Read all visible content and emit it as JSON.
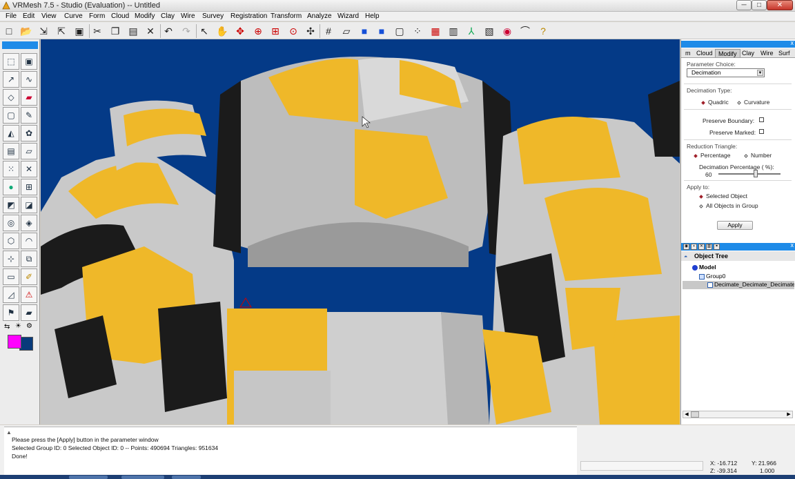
{
  "window": {
    "title": "VRMesh 7.5 - Studio (Evaluation) -- Untitled",
    "buttons": {
      "minimize": "─",
      "maximize": "□",
      "close": "✕"
    }
  },
  "menu": [
    "File",
    "Edit",
    "View",
    "Curve",
    "Form",
    "Cloud",
    "Modify",
    "Clay",
    "Wire",
    "Survey",
    "Registration",
    "Transform",
    "Analyze",
    "Wizard",
    "Help"
  ],
  "toolbar_icons": [
    "new-icon",
    "open-icon",
    "import-icon",
    "export-icon",
    "save-icon",
    "cut-icon",
    "copy-icon",
    "paste-icon",
    "delete-icon",
    "undo-icon",
    "redo-icon",
    "select-icon",
    "pan-icon",
    "rotate-icon",
    "zoom-icon",
    "zoom-window-icon",
    "zoom-fit-icon",
    "zoom-all-icon",
    "grid-icon",
    "grid-skew-icon",
    "shaded-icon",
    "shaded-solid-icon",
    "wireframe-icon",
    "point-display-icon",
    "view-top-icon",
    "view-front-icon",
    "axis-icon",
    "properties-icon",
    "color-map-icon",
    "curvature-icon",
    "help-icon"
  ],
  "palette": {
    "icons": [
      "point-edit-icon",
      "box-select-icon",
      "curve-icon",
      "spline-icon",
      "plane-icon",
      "cut-plane-icon",
      "cube-icon",
      "brush-icon",
      "surface-icon",
      "texture-icon",
      "mesh-icon",
      "parallelogram-icon",
      "scatter-icon",
      "cross-icon",
      "globe-icon",
      "grid-points-icon",
      "fold-icon",
      "sweep-icon",
      "sphere-icon",
      "patch-icon",
      "box-mesh-icon",
      "arc-icon",
      "nodes-icon",
      "connect-icon",
      "patch-flat-icon",
      "pen-icon",
      "triangle-icon",
      "warning-icon",
      "flag-icon",
      "layer-icon"
    ],
    "small_icons": [
      "link-icon",
      "light-icon",
      "gear-icon"
    ],
    "colors": {
      "foreground": "#ff00ff",
      "background": "#083a7a"
    }
  },
  "viewport": {
    "background": "#043a87",
    "scan_colors": {
      "gray": "#c9c9c9",
      "dark": "#1b1b1b",
      "yellow": "#efb829"
    }
  },
  "right_panel": {
    "tabs": [
      "m",
      "Cloud",
      "Modify",
      "Clay",
      "Wire",
      "Surf"
    ],
    "active_tab": "Modify",
    "close": "x",
    "parameter_choice_label": "Parameter Choice:",
    "parameter_choice_value": "Decimation",
    "decimation_type_label": "Decimation Type:",
    "decimation_type_options": [
      "Quadric",
      "Curvature"
    ],
    "decimation_type_selected": "Quadric",
    "preserve_boundary_label": "Preserve Boundary:",
    "preserve_marked_label": "Preserve Marked:",
    "reduction_triangle_label": "Reduction Triangle:",
    "reduction_options": [
      "Percentage",
      "Number"
    ],
    "reduction_selected": "Percentage",
    "decimation_percentage_label": "Decimation Percentage ( %):",
    "decimation_percentage_value": "60",
    "decimation_percentage_fraction": 0.6,
    "apply_to_label": "Apply to:",
    "apply_to_options": [
      "Selected Object",
      "All Objects in Group"
    ],
    "apply_to_selected": "Selected Object",
    "apply_button": "Apply"
  },
  "object_tree": {
    "title": "Object Tree",
    "close": "x",
    "nodes": [
      "Model",
      "Group0",
      "Decimate_Decimate_Decimate"
    ],
    "selected": "Decimate_Decimate_Decimate",
    "scroll_left": "◀",
    "scroll_right": "▶"
  },
  "status": {
    "lines": [
      "Please press the [Apply] button in the parameter window",
      "Selected Group ID: 0  Selected Object ID: 0  -- Points: 490694  Triangles: 951634",
      "Done!"
    ],
    "scroll_indicator": "▲",
    "coords": {
      "x_label": "X: -16.712",
      "y_label": "Y: 21.966",
      "z_label": "Z: -39.314",
      "unit": "1.000"
    }
  }
}
